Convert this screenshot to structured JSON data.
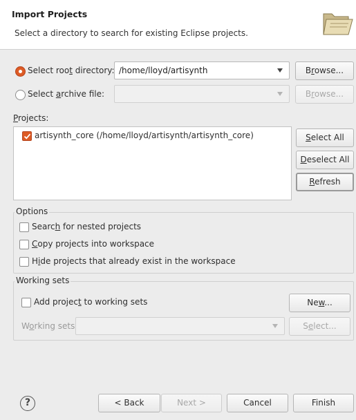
{
  "header": {
    "title": "Import Projects",
    "description": "Select a directory to search for existing Eclipse projects.",
    "icon": "folder-import-icon"
  },
  "source": {
    "root_dir": {
      "label_pre": "Select roo",
      "label_ul": "t",
      "label_post": " directory:",
      "value": "/home/lloyd/artisynth",
      "checked": true
    },
    "archive": {
      "label_pre": "Select ",
      "label_ul": "a",
      "label_post": "rchive file:",
      "value": "",
      "checked": false
    },
    "browse_root": {
      "pre": "B",
      "ul": "r",
      "post": "owse..."
    },
    "browse_archive": {
      "pre": "B",
      "ul": "r",
      "post": "owse..."
    }
  },
  "projects": {
    "label_ul": "P",
    "label_post": "rojects:",
    "items": [
      {
        "label": "artisynth_core (/home/lloyd/artisynth/artisynth_core)",
        "checked": true
      }
    ],
    "select_all": {
      "ul": "S",
      "post": "elect All"
    },
    "deselect_all": {
      "ul": "D",
      "post": "eselect All"
    },
    "refresh": {
      "ul": "R",
      "post": "efresh"
    }
  },
  "options": {
    "title": "Options",
    "nested": {
      "pre": "Searc",
      "ul": "h",
      "post": " for nested projects",
      "checked": false
    },
    "copy": {
      "pre": "",
      "ul": "C",
      "post": "opy projects into workspace",
      "checked": false
    },
    "hide": {
      "pre": "H",
      "ul": "i",
      "post": "de projects that already exist in the workspace",
      "checked": false
    }
  },
  "working_sets": {
    "title": "Working sets",
    "add": {
      "pre": "Add projec",
      "ul": "t",
      "post": " to working sets",
      "checked": false
    },
    "new": {
      "pre": "Ne",
      "ul": "w",
      "post": "..."
    },
    "sets_label": {
      "pre": "W",
      "ul": "o",
      "post": "rking sets:"
    },
    "select": {
      "pre": "S",
      "ul": "e",
      "post": "lect..."
    }
  },
  "footer": {
    "help": "?",
    "back": "< Back",
    "next": "Next >",
    "cancel": "Cancel",
    "finish": "Finish"
  },
  "colors": {
    "accent": "#dd5b25",
    "background": "#ececec"
  }
}
